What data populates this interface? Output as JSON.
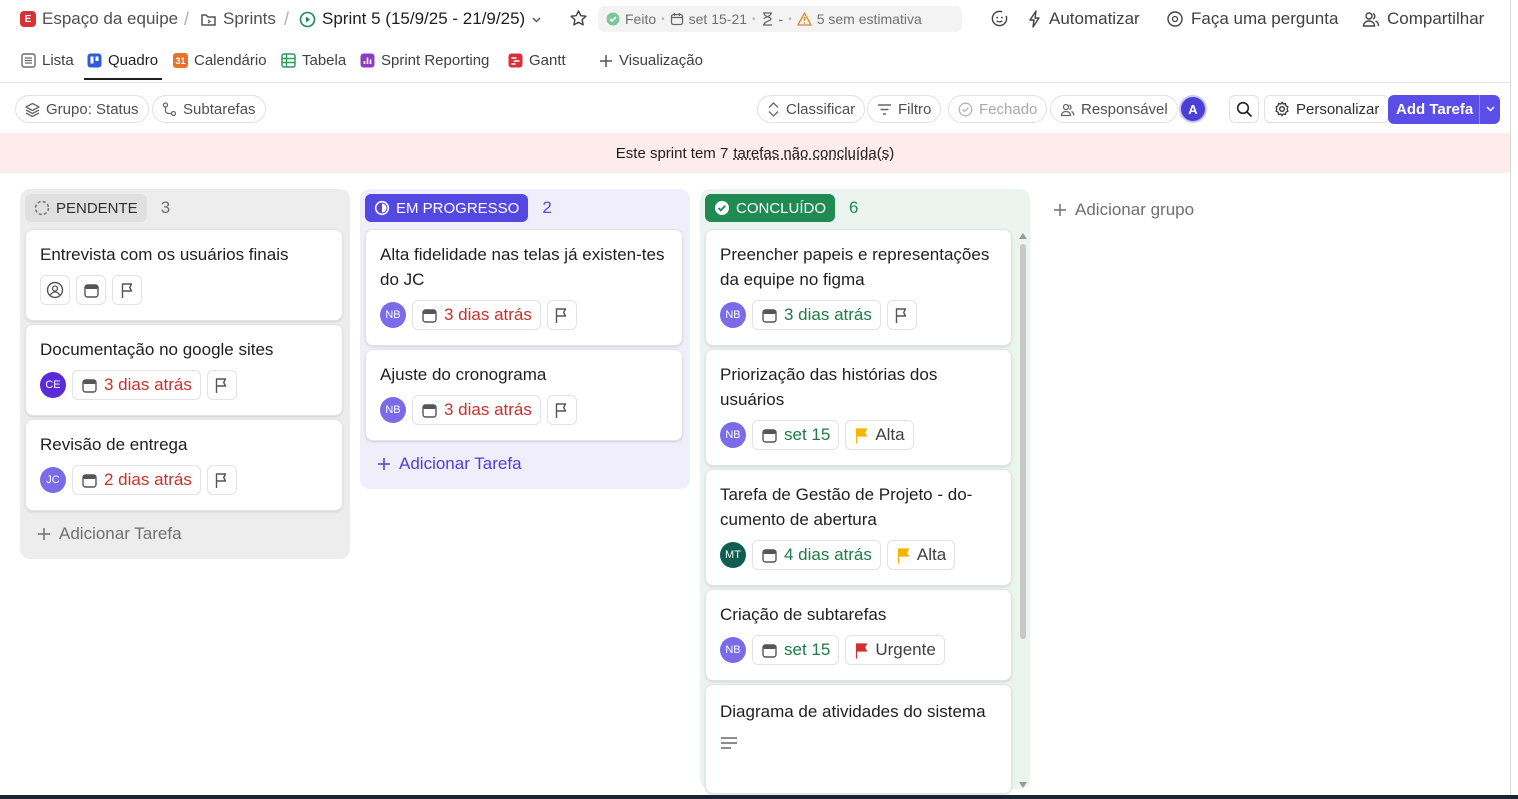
{
  "breadcrumb": {
    "space": "Espaço da equipe",
    "space_badge": "E",
    "folder": "Sprints",
    "sprint": "Sprint 5 (15/9/25 - 21/9/25)"
  },
  "status_chip": {
    "status": "Feito",
    "dates": "set 15-21",
    "time": "-",
    "estimate_warning": "5 sem estimativa"
  },
  "top_actions": {
    "automate": "Automatizar",
    "ask": "Faça uma pergunta",
    "share": "Compartilhar"
  },
  "view_tabs": [
    {
      "label": "Lista",
      "icon": "list-icon",
      "color": "#6b6b6b"
    },
    {
      "label": "Quadro",
      "icon": "board-icon",
      "color": "#2e5bd8",
      "active": true
    },
    {
      "label": "Calendário",
      "icon": "calendar-icon",
      "color": "#e8722b",
      "badge": "31"
    },
    {
      "label": "Tabela",
      "icon": "table-icon",
      "color": "#2f9c5b"
    },
    {
      "label": "Sprint Reporting",
      "icon": "bar-chart-icon",
      "color": "#8e3cc2"
    },
    {
      "label": "Gantt",
      "icon": "gantt-icon",
      "color": "#d93038"
    }
  ],
  "add_view": "Visualização",
  "toolbar": {
    "group": "Grupo: Status",
    "subtasks": "Subtarefas",
    "sort": "Classificar",
    "filter": "Filtro",
    "closed": "Fechado",
    "assignee": "Responsável",
    "avatar": "A",
    "customize": "Personalizar",
    "add_task": "Add Tarefa"
  },
  "banner": {
    "prefix": "Este sprint tem 7",
    "link": "tarefas não concluída(s)"
  },
  "columns": {
    "pending": {
      "label": "PENDENTE",
      "count": "3",
      "add": "Adicionar Tarefa",
      "cards": [
        {
          "title": "Entrevista com os usuários finais"
        },
        {
          "title": "Documentação no google sites",
          "avatar": "CE",
          "date": "3 dias atrás"
        },
        {
          "title": "Revisão de entrega",
          "avatar": "JC",
          "date": "2 dias atrás"
        }
      ]
    },
    "progress": {
      "label": "EM PROGRESSO",
      "count": "2",
      "add": "Adicionar Tarefa",
      "cards": [
        {
          "title": "Alta fidelidade nas telas já existen-tes do JC",
          "avatar": "NB",
          "date": "3 dias atrás"
        },
        {
          "title": "Ajuste do cronograma",
          "avatar": "NB",
          "date": "3 dias atrás"
        }
      ]
    },
    "done": {
      "label": "CONCLUÍDO",
      "count": "6",
      "cards": [
        {
          "title": "Preencher papeis e representações da equipe no figma",
          "avatar": "NB",
          "date": "3 dias atrás"
        },
        {
          "title": "Priorização das histórias dos usuários",
          "avatar": "NB",
          "date": "set 15",
          "priority": "Alta"
        },
        {
          "title": "Tarefa de Gestão de Projeto - do-cumento de abertura",
          "avatar": "MT",
          "date": "4 dias atrás",
          "priority": "Alta"
        },
        {
          "title": "Criação de subtarefas",
          "avatar": "NB",
          "date": "set 15",
          "priority": "Urgente"
        },
        {
          "title": "Diagrama de atividades do sistema"
        }
      ]
    }
  },
  "add_group": "Adicionar grupo",
  "colors": {
    "accent": "#5b4ee8",
    "overdue": "#c4322e",
    "done": "#1e7a47",
    "priority_high": "#f5b400",
    "priority_urgent": "#d32f2f"
  }
}
